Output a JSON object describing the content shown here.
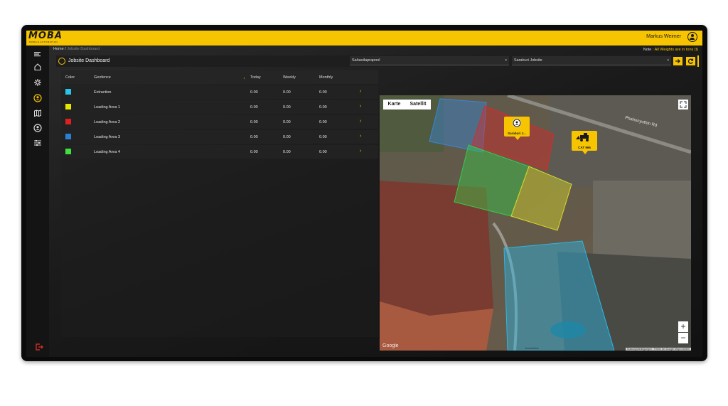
{
  "header": {
    "logo": "MOBA",
    "logo_sub": "MOBILE AUTOMATION",
    "user_name": "Markus Weimer"
  },
  "breadcrumb": {
    "home": "Home",
    "separator": "/",
    "current": "Jobsite Dashboard"
  },
  "note": {
    "label": "Note :",
    "text": "All Weights are in tons (t)"
  },
  "titlebar": {
    "title": "Jobsite Dashboard",
    "select1": "Sahasilaprapool",
    "select2": "Saraburi Jobsite"
  },
  "table": {
    "headers": {
      "color": "Color",
      "geofence": "Geofence",
      "sort_indicator": "↓",
      "today": "Today",
      "weekly": "Weekly",
      "monthly": "Monthly"
    },
    "rows": [
      {
        "name": "Extraction",
        "color": "#27c6e8",
        "today": "0.00",
        "weekly": "0.00",
        "monthly": "0.00"
      },
      {
        "name": "Loading Area 1",
        "color": "#e6e600",
        "today": "0.00",
        "weekly": "0.00",
        "monthly": "0.00"
      },
      {
        "name": "Loading Area 2",
        "color": "#e01f1f",
        "today": "0.00",
        "weekly": "0.00",
        "monthly": "0.00"
      },
      {
        "name": "Loading Area 3",
        "color": "#2a7fd6",
        "today": "0.00",
        "weekly": "0.00",
        "monthly": "0.00"
      },
      {
        "name": "Loading Area 4",
        "color": "#3ee23e",
        "today": "0.00",
        "weekly": "0.00",
        "monthly": "0.00"
      }
    ]
  },
  "map": {
    "type_map": "Karte",
    "type_satellite": "Satellit",
    "marker1_label": "Saraburi J...",
    "marker2_label": "CAT 966",
    "road_label": "Phahonyothin Rd",
    "zoom_in": "+",
    "zoom_out": "−",
    "google": "Google",
    "scale_label": "Kurzbefehle",
    "attribution": "Nutzungsbedingungen · Fehler bei Google Maps melden"
  },
  "colors": {
    "accent": "#f6c400"
  }
}
